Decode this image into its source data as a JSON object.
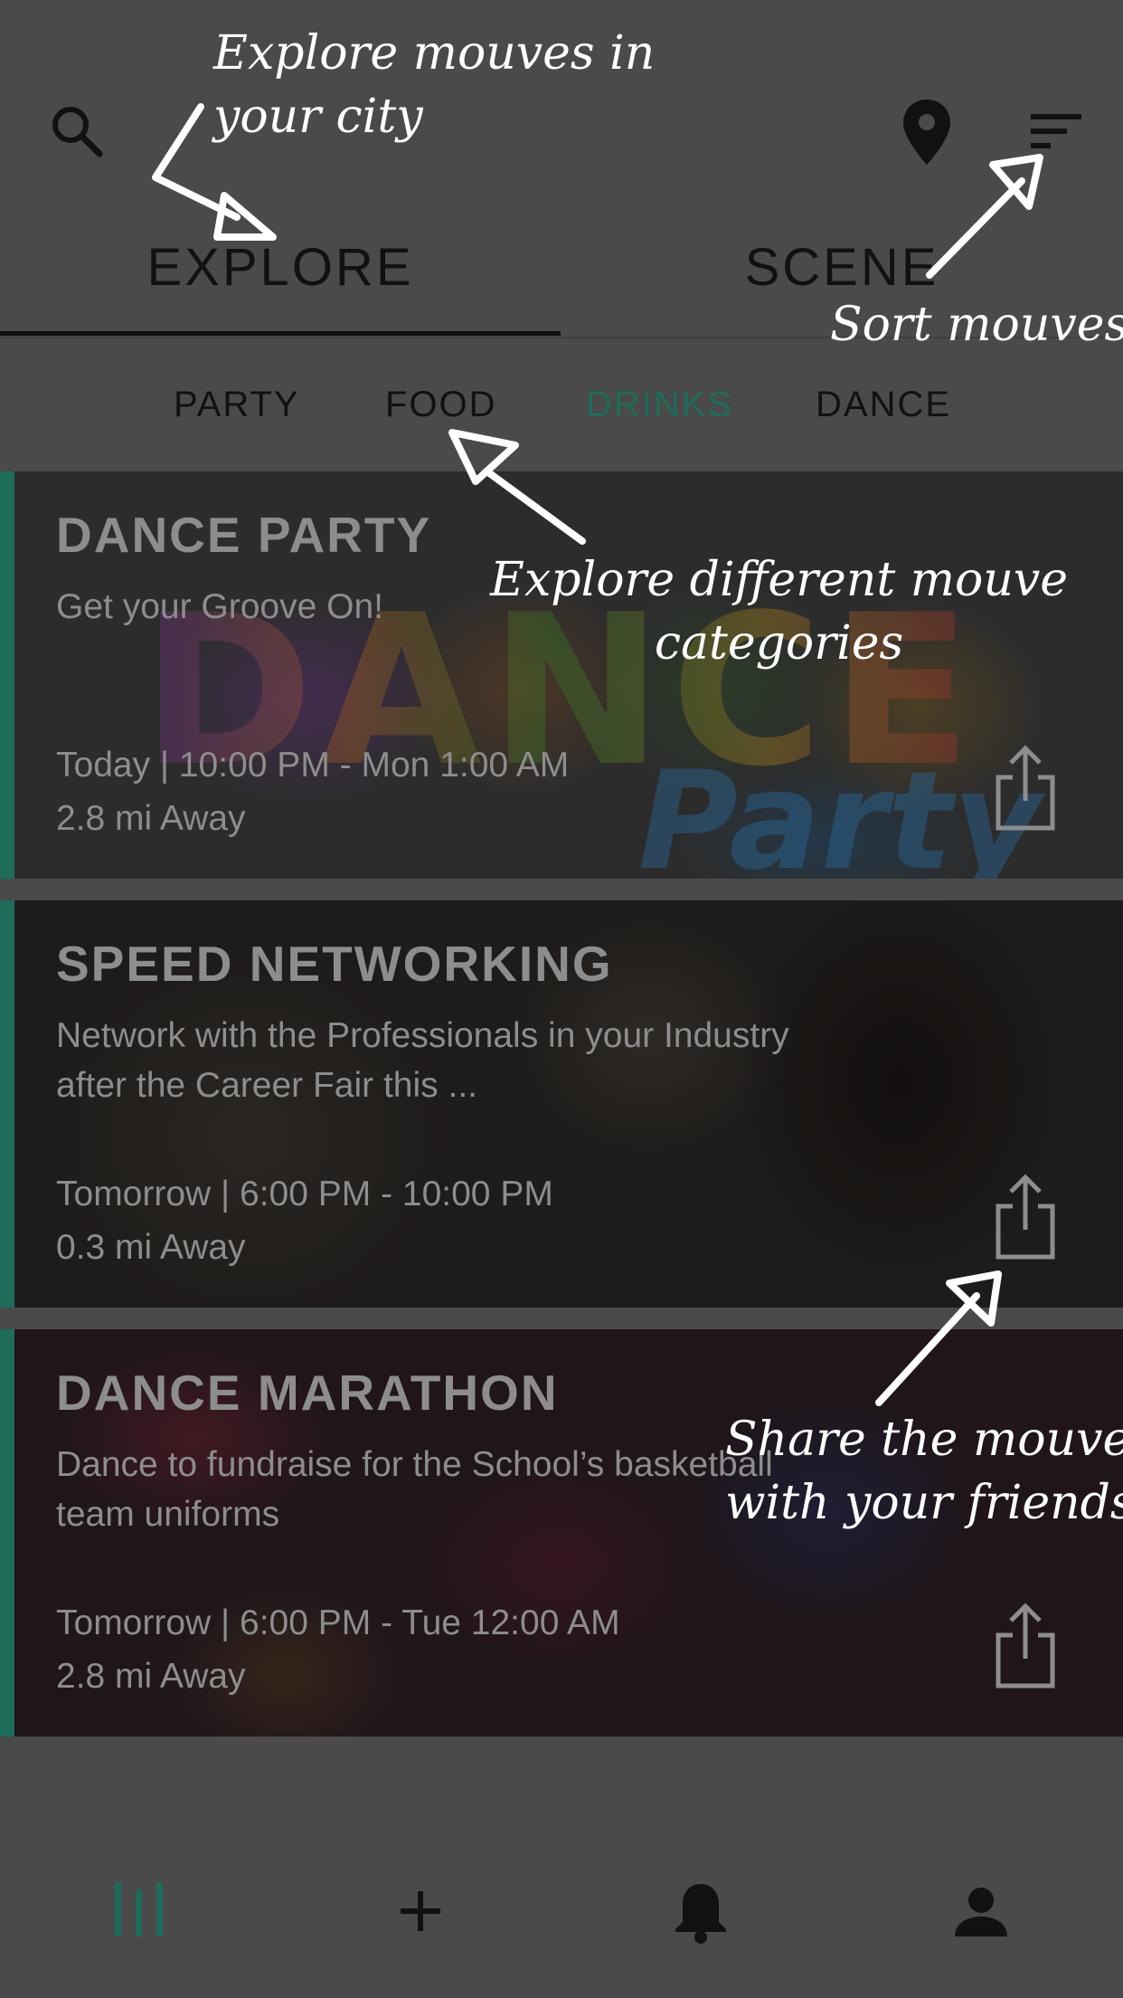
{
  "header": {
    "tabs": [
      {
        "label": "EXPLORE",
        "active": true
      },
      {
        "label": "SCENE",
        "active": false
      }
    ],
    "icons": {
      "search": "search-icon",
      "location": "location-pin-icon",
      "sort": "sort-icon"
    }
  },
  "categories": [
    {
      "label": "PARTY",
      "active": false
    },
    {
      "label": "FOOD",
      "active": false
    },
    {
      "label": "DRINKS",
      "active": true
    },
    {
      "label": "DANCE",
      "active": false
    }
  ],
  "events": [
    {
      "title": "DANCE PARTY",
      "description": "Get your Groove On!",
      "time": "Today | 10:00 PM - Mon 1:00 AM",
      "distance": "2.8 mi Away",
      "background_text": [
        "DANCE",
        "Party"
      ]
    },
    {
      "title": "SPEED NETWORKING",
      "description": "Network with the Professionals in your Industry after the Career Fair this ...",
      "time": "Tomorrow | 6:00 PM - 10:00 PM",
      "distance": "0.3 mi Away"
    },
    {
      "title": "DANCE MARATHON",
      "description": "Dance to fundraise for the School’s basketball team uniforms",
      "time": "Tomorrow | 6:00 PM - Tue 12:00 AM",
      "distance": "2.8 mi Away"
    }
  ],
  "bottom_nav": {
    "items": [
      "feed-icon",
      "add-icon",
      "bell-icon",
      "profile-icon"
    ],
    "active": "feed-icon"
  },
  "annotations": {
    "explore": [
      "Explore mouves in",
      "your city"
    ],
    "sort": "Sort mouves",
    "categories": [
      "Explore different mouve",
      "categories"
    ],
    "share": [
      "Share the mouve",
      "with your friends"
    ]
  },
  "colors": {
    "accent": "#1f6b5a",
    "overlay_bg": "#4a4a4a",
    "text_dark": "#111111",
    "card_text": "#8d8d8d"
  }
}
